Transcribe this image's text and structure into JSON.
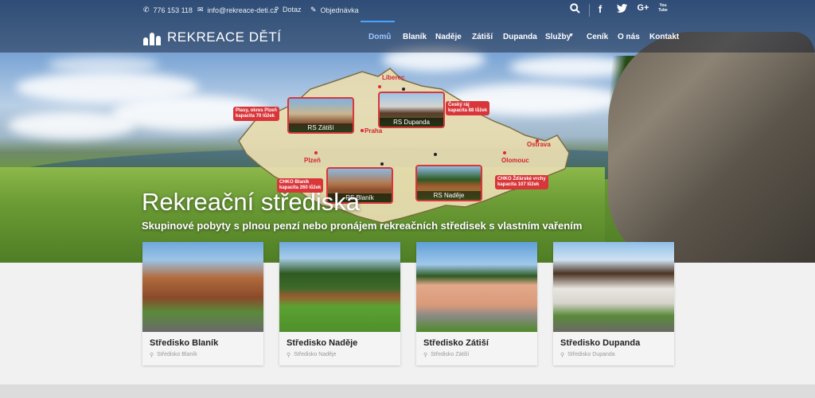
{
  "contact": {
    "phone": "776 153 118",
    "email": "info@rekreace-deti.cz",
    "question": "Dotaz",
    "order": "Objednávka"
  },
  "icons": {
    "phone": "phone-icon",
    "email": "envelope-icon",
    "question": "question-icon",
    "order": "pencil-icon",
    "search": "search-icon",
    "facebook": "facebook-icon",
    "twitter": "twitter-icon",
    "googleplus": "googleplus-icon",
    "youtube": "youtube-icon",
    "location": "map-marker-icon"
  },
  "social": {
    "facebook": "f",
    "googleplus": "G+",
    "youtube": "You Tube"
  },
  "logo": {
    "text": "REKREACE DĚTÍ"
  },
  "nav": [
    {
      "label": "Domů",
      "active": true
    },
    {
      "label": "Blaník"
    },
    {
      "label": "Naděje"
    },
    {
      "label": "Zátiší"
    },
    {
      "label": "Dupanda"
    },
    {
      "label": "Služby"
    },
    {
      "label": "Ceník"
    },
    {
      "label": "O nás"
    },
    {
      "label": "Kontakt"
    }
  ],
  "map": {
    "cities": {
      "liberec": "Liberec",
      "praha": "Praha",
      "plzen": "Plzeň",
      "olomouc": "Olomouc",
      "ostrava": "Ostrava"
    },
    "callouts": {
      "zatisi": [
        "Plasy, okres Plzeň",
        "kapacita 70 lůžek"
      ],
      "dupanda": [
        "Český ráj",
        "kapacita 88 lůžek"
      ],
      "blanik": [
        "CHKO Blaník",
        "kapacita 260 lůžek"
      ],
      "nadeje": [
        "CHKO Žďárské vrchy",
        "kapacita 107 lůžek"
      ]
    },
    "photos": {
      "zatisi": "RS Zátiší",
      "dupanda": "RS Dupanda",
      "blanik": "RS Blaník",
      "nadeje": "RS Naděje"
    }
  },
  "hero": {
    "title": "Rekreační střediska",
    "subtitle": "Skupinové pobyty s plnou penzí nebo pronájem rekreačních středisek s vlastním vařením"
  },
  "cards": [
    {
      "title": "Středisko Blaník",
      "location": "Středisko Blaník"
    },
    {
      "title": "Středisko Naděje",
      "location": "Středisko Naděje"
    },
    {
      "title": "Středisko Zátiší",
      "location": "Středisko Zátiší"
    },
    {
      "title": "Středisko Dupanda",
      "location": "Středisko Dupanda"
    }
  ],
  "colors": {
    "accent": "#4aa3ff",
    "map_red": "#d9363a"
  }
}
